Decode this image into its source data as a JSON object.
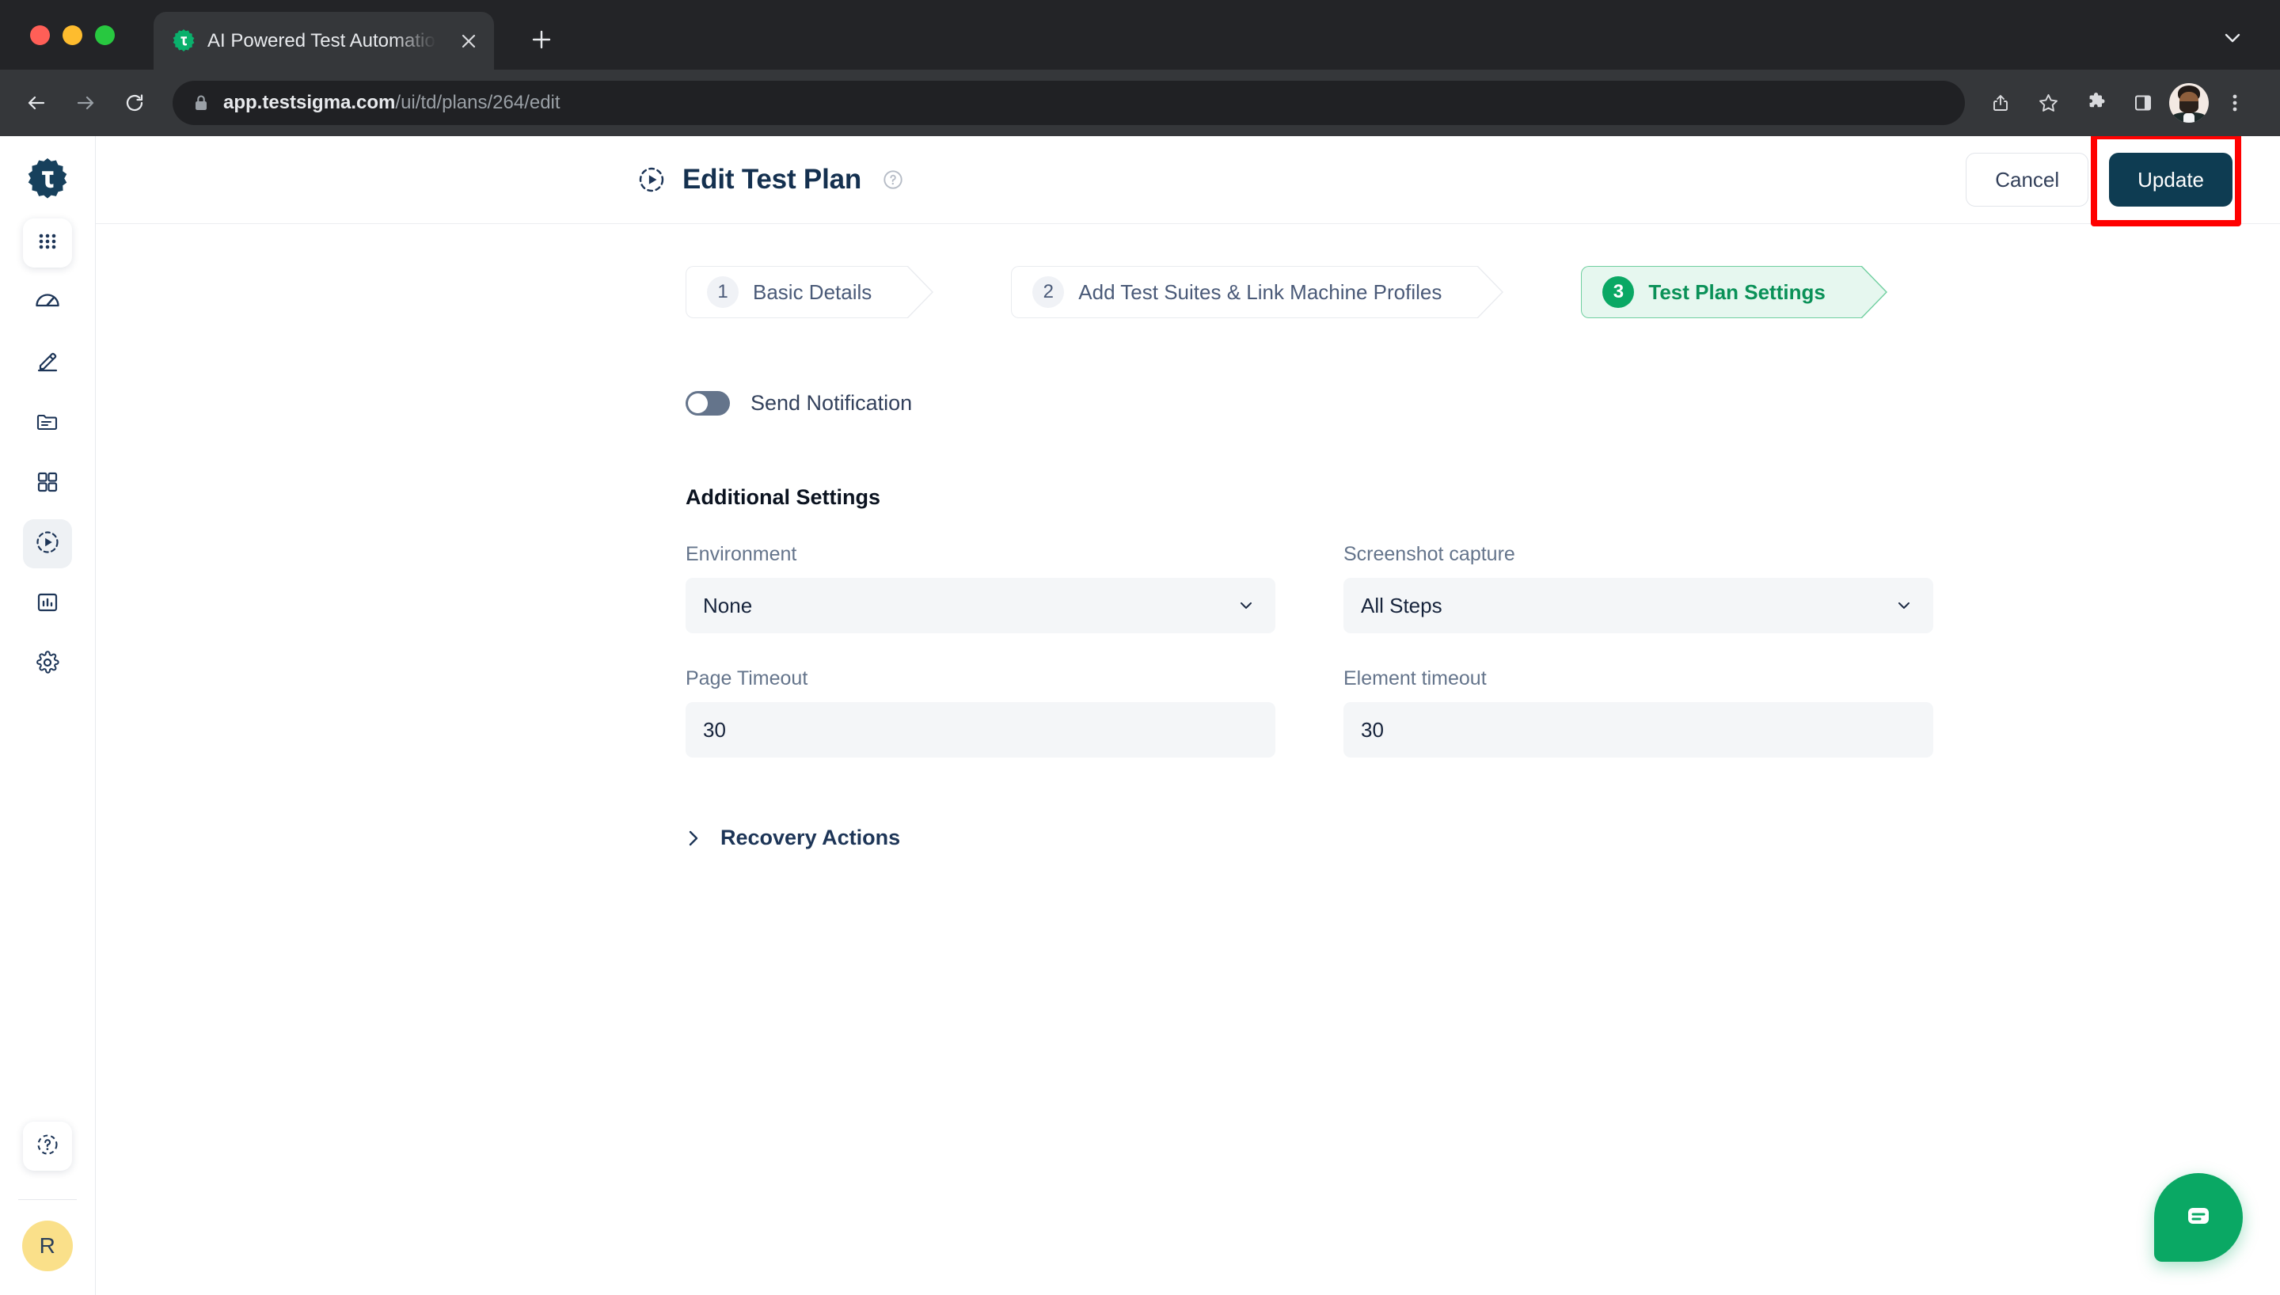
{
  "browser": {
    "tab": {
      "title": "AI Powered Test Automation Pl",
      "favicon": "testsigma-logo-icon",
      "close": "close-icon",
      "new_tab": "plus-icon",
      "tab_list_chevron": "chevron-down-icon"
    },
    "toolbar": {
      "back": "back-arrow-icon",
      "forward": "forward-arrow-icon",
      "reload": "reload-icon",
      "lock": "lock-icon",
      "url_bold": "app.testsigma.com",
      "url_rest": "/ui/td/plans/264/edit",
      "share": "share-icon",
      "bookmark": "star-icon",
      "extensions": "puzzle-icon",
      "side_panel": "side-panel-icon",
      "profile": "profile-avatar",
      "menu": "three-dot-menu-icon"
    }
  },
  "sidebar": {
    "brand": "testsigma-logo-icon",
    "items": [
      {
        "name": "apps-grid",
        "icon": "apps-grid-icon"
      },
      {
        "name": "dashboard",
        "icon": "speedometer-icon"
      },
      {
        "name": "create-tests",
        "icon": "pencil-icon"
      },
      {
        "name": "test-data",
        "icon": "folder-icon"
      },
      {
        "name": "test-suites",
        "icon": "grid-squares-icon"
      },
      {
        "name": "test-plans",
        "icon": "test-plan-run-icon"
      },
      {
        "name": "reports",
        "icon": "bar-chart-icon"
      },
      {
        "name": "settings",
        "icon": "gear-icon"
      }
    ],
    "help": "help-circle-icon",
    "avatar_initial": "R"
  },
  "header": {
    "icon": "test-plan-run-icon",
    "title": "Edit Test Plan",
    "help": "help-circle-icon",
    "cancel_label": "Cancel",
    "update_label": "Update",
    "annotation_color": "#ff0000"
  },
  "stepper": {
    "steps": [
      {
        "number": "1",
        "label": "Basic Details",
        "active": false
      },
      {
        "number": "2",
        "label": "Add Test Suites & Link Machine Profiles",
        "active": false
      },
      {
        "number": "3",
        "label": "Test Plan Settings",
        "active": true
      }
    ],
    "active_bg": "#e6f7ef",
    "active_color": "#0a9158"
  },
  "settings": {
    "send_notification": {
      "label": "Send Notification",
      "enabled": false
    },
    "section_title": "Additional Settings",
    "fields": [
      {
        "label": "Environment",
        "value": "None",
        "type": "select"
      },
      {
        "label": "Screenshot capture",
        "value": "All Steps",
        "type": "select"
      },
      {
        "label": "Page Timeout",
        "value": "30",
        "type": "text"
      },
      {
        "label": "Element timeout",
        "value": "30",
        "type": "text"
      }
    ],
    "recovery": {
      "label": "Recovery Actions",
      "chevron": "chevron-right-icon",
      "expanded": false
    }
  },
  "chat": {
    "icon": "chat-bubble-icon",
    "color": "#0aa864"
  }
}
